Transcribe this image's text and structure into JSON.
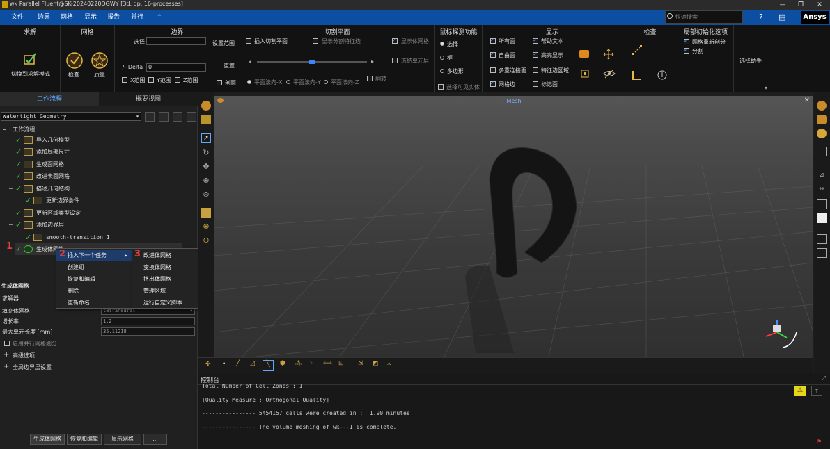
{
  "titlebar": {
    "title": "wk Parallel Fluent@SK-20240220DGWY  [3d, dp, 16-processes]"
  },
  "menubar": {
    "items": [
      "文件",
      "边界",
      "网格",
      "显示",
      "报告",
      "并行",
      "⌃"
    ],
    "search_placeholder": "快速搜索",
    "brand": "Ansys"
  },
  "ribbon": {
    "solve": {
      "title": "求解",
      "switch_label": "切换到求解模式"
    },
    "mesh": {
      "title": "网格",
      "check_label": "检查",
      "quality_label": "质量"
    },
    "boundary": {
      "title": "边界",
      "select_label": "选择",
      "set_range": "设置范围",
      "delta_label": "+/- Delta",
      "delta_value": "0",
      "reset": "重置",
      "x_range": "X范围",
      "y_range": "Y范围",
      "z_range": "Z范围",
      "section": "剖面"
    },
    "cut": {
      "title": "切割平面",
      "insert": "插入切割平面",
      "show_edges": "显示分割特征边",
      "show_mesh": "显示体网格",
      "freeze": "冻结单元层",
      "flip": "翻转",
      "plane_x": "平面法向-X",
      "plane_y": "平面法向-Y",
      "plane_z": "平面法向-Z",
      "select_visible": "选择可见实体"
    },
    "probe": {
      "title": "鼠标探测功能",
      "select": "选择",
      "box": "框",
      "polygon": "多边形"
    },
    "display": {
      "title": "显示",
      "all_faces": "所有面",
      "help_text": "帮助文本",
      "free_faces": "自由面",
      "highlight": "高亮显示",
      "multi_conn": "多重连接面",
      "feature_edge": "特征边区域",
      "mesh_edges": "网格边",
      "label": "标记面"
    },
    "inspect": {
      "title": "检查"
    },
    "local_init": {
      "title": "局部初始化选项",
      "remesh": "网格重新剖分",
      "split": "分割"
    },
    "select_helper": "选择助手"
  },
  "left_panel": {
    "tabs": [
      "工作流程",
      "概要视图"
    ],
    "workflow_type": "Watertight Geometry",
    "tree_root": "工作流程",
    "tree": [
      "导入几何模型",
      "添加局部尺寸",
      "生成面网格",
      "改进表面网格",
      "描述几何结构",
      "更新边界条件",
      "更新区域类型设定",
      "添加边界层",
      "smooth-transition_1",
      "生成体网格"
    ],
    "context_menu": [
      "插入下一个任务",
      "创建组",
      "恢复和编辑",
      "删除",
      "重新命名"
    ],
    "submenu": [
      "改进体网格",
      "变换体网格",
      "挤出体网格",
      "管理区域",
      "运行自定义脚本"
    ],
    "annotations": [
      "1",
      "2",
      "3"
    ],
    "props_title": "生成体网格",
    "solver_label": "求解器",
    "fill_label": "填充体网格",
    "fill_value": "tetrahedral",
    "growth_label": "增长率",
    "growth_value": "1.2",
    "max_len_label": "最大单元长度 [mm]",
    "max_len_value": "35.11218",
    "parallel_label": "启用并行网格划分",
    "advanced_label": "高级选项",
    "global_bl_label": "全局边界层设置",
    "buttons": [
      "生成体网格",
      "恢复和编辑",
      "显示网格",
      "..."
    ]
  },
  "viewport": {
    "title": "Mesh"
  },
  "console": {
    "title": "控制台",
    "lines": [
      "Total Number of Cell Zones : 1",
      "[Quality Measure : Orthogonal Quality]",
      "---------------- 5454157 cells were created in :  1.90 minutes",
      "---------------- The volume meshing of wk---1 is complete."
    ]
  },
  "colors": {
    "menubar": "#0c4ea2",
    "accent": "#5ea8ff",
    "check": "#3fc43f",
    "annotation": "#e43d3d"
  }
}
